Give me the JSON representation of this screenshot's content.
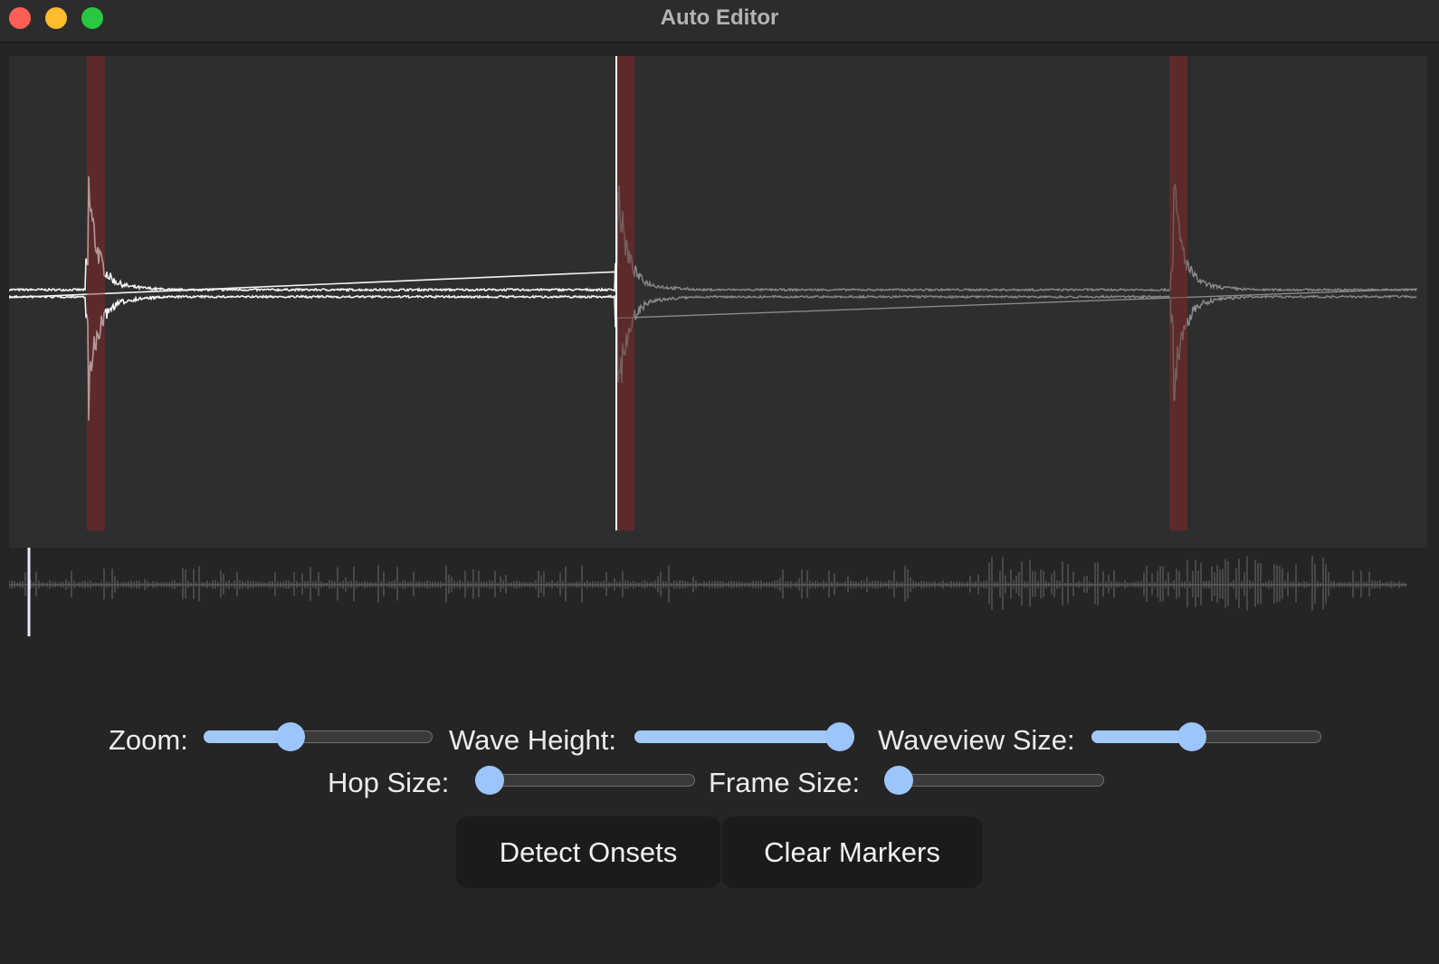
{
  "window": {
    "title": "Auto Editor",
    "buttons": [
      "close",
      "minimize",
      "maximize"
    ]
  },
  "waveform": {
    "played_color": "#ffffff",
    "unplayed_color": "#8a8a8a",
    "marker_color": "#5e2b2b",
    "background_color": "#2e2e2e",
    "playhead_color": "#ffffff",
    "marker_count": 3
  },
  "overview": {
    "wave_color": "#6a6a6a",
    "playhead_color": "#e8e8ff"
  },
  "controls": {
    "zoom": {
      "label": "Zoom:",
      "value": 0.36
    },
    "wave_height": {
      "label": "Wave Height:",
      "value": 1.0
    },
    "waveview_size": {
      "label": "Waveview Size:",
      "value": 0.43
    },
    "hop_size": {
      "label": "Hop Size:",
      "value": 0.0
    },
    "frame_size": {
      "label": "Frame Size:",
      "value": 0.0
    }
  },
  "actions": {
    "detect_onsets": "Detect Onsets",
    "clear_markers": "Clear Markers"
  },
  "accent_color": "#9cc6fb"
}
